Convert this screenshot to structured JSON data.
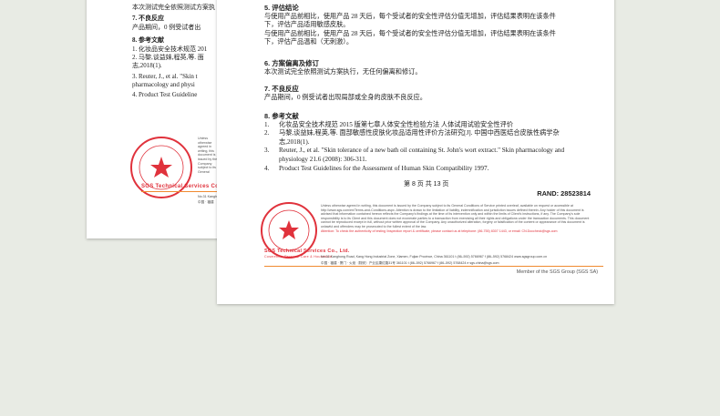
{
  "back_page": {
    "top_line": "本次测试完全依照测试方案执",
    "sec7_title": "7.   不良反应",
    "sec7_text": "产品期间，0 例受试者出",
    "sec8_title": "8.   参考文献",
    "refs": [
      "1.    化妆品安全技术规范 201",
      "2.    马黎,谈益妹,程英,等. 面",
      "        志,2018(1).",
      "3.    Reuter, J., et al. \"Skin t",
      "        pharmacology and physi",
      "4.    Product Test Guideline"
    ],
    "stamp_text": "SGS Technical Services Co., Ltd.",
    "fine_lead": "Unless otherwise agreed in writing, this document is issued by the Company subject to its General Conditions of Service printed overleaf, available on request or accessible at http://www.sgs.com/en/Terms-and-Conditions.aspx.",
    "addr_line1": "No.31 Kanghong Road, Kang",
    "addr_line2": "中国 · 福建"
  },
  "front_page": {
    "sec5_title": "5.    评估结论",
    "sec5_lines": [
      "与使用产品前相比，使用产品 28 天后，每个受试者的安全性评估分值无增加，评估结果表明在该条件",
      "下，评估产品适用敏感皮肤。",
      "与使用产品前相比，使用产品 28 天后，每个受试者的安全性评估分值无增加，评估结果表明在该条件",
      "下，评估产品温和（无刺激）。"
    ],
    "sec6_title": "6.    方案偏离及修订",
    "sec6_text": "本次测试完全依照测试方案执行，无任何偏离和修订。",
    "sec7_title": "7.    不良反应",
    "sec7_text": "产品期间，0 例受试者出现局部或全身的皮肤不良反应。",
    "sec8_title": "8.    参考文献",
    "refs": [
      {
        "n": "1.",
        "t": "化妆品安全技术规范 2015 版第七章人体安全性检验方法 人体试用试验安全性评价"
      },
      {
        "n": "2.",
        "t": "马黎,谈益妹,程英,等. 面部敏感性皮肤化妆品适用性评价方法研究[J]. 中国中西医结合皮肤性病学杂志,2018(1)."
      },
      {
        "n": "3.",
        "t": "Reuter, J., et al. \"Skin tolerance of a new bath oil containing St. John's wort extract.\" Skin pharmacology and physiology 21.6 (2008): 306-311."
      },
      {
        "n": "4.",
        "t": "Product Test Guidelines for the Assessment of Human Skin Compatibility 1997."
      }
    ],
    "page_number": "第 8 页 共 13 页",
    "rand": "RAND: 28523814",
    "stamp_logo": "SGS Technical Services Co., Ltd.",
    "stamp_sub": "Cosmetics, Personal Care & Household",
    "fine_print": "Unless otherwise agreed in writing, this document is issued by the Company subject to its General Conditions of Service printed overleaf, available on request or accessible at http://www.sgs.com/en/Terms-and-Conditions.aspx. Attention is drawn to the limitation of liability, indemnification and jurisdiction issues defined therein. Any holder of this document is advised that information contained hereon reflects the Company's findings at the time of its intervention only and within the limits of Client's instructions, if any. The Company's sole responsibility is to its Client and this document does not exonerate parties to a transaction from exercising all their rights and obligations under the transaction documents. This document cannot be reproduced except in full, without prior written approval of the Company. Any unauthorized alteration, forgery or falsification of the content or appearance of this document is unlawful and offenders may be prosecuted to the fullest extent of the law.",
    "fine_attention": "Attention: To check the authenticity of testing /inspection report & certificate, please contact us at telephone: (86-755) 8307 1443, or email: CN.Doccheck@sgs.com",
    "addr1": "No.31 Kanghong Road, Kang Hong Industrial Zone, Xiamen, Fujian Province, China    361101    t (86–592) 5766967    f (86–592) 5768424    www.sgsgroup.com.cn",
    "addr2": "中国 · 福建 · 厦门 · 火炬（翔安）产业区康红路31号    361101    t (86–592) 5766967    f (86–592) 5768424    e sgs.china@sgs.com",
    "member": "Member of the SGS Group (SGS SA)"
  },
  "colors": {
    "stamp_red": "#e0323c",
    "accent_orange": "#f08a30",
    "background": "#e8ebe4"
  }
}
